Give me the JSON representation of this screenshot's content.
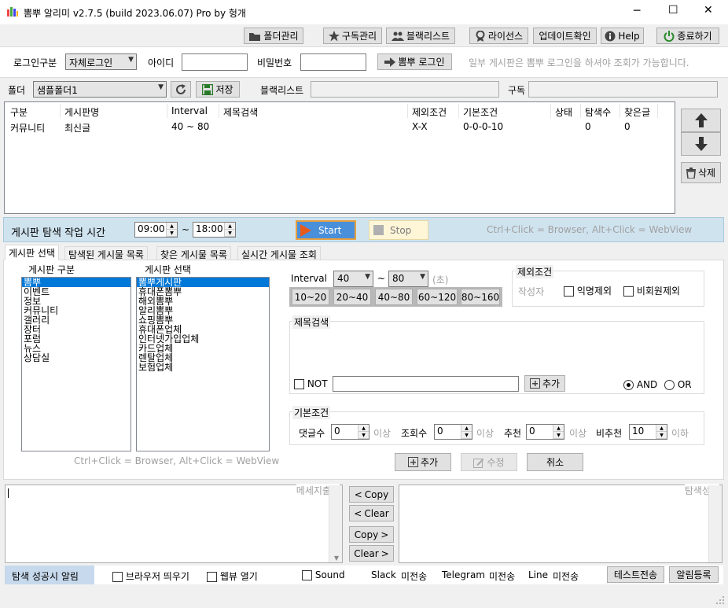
{
  "window": {
    "title": "뽐뿌 알리미 v2.7.5 (build 2023.06.07) Pro by 헝개",
    "minimize": "─",
    "maximize": "☐",
    "close": "✕"
  },
  "toolbar": {
    "folder_manage": "폴더관리",
    "subscribe_manage": "구독관리",
    "blacklist": "블랙리스트",
    "license": "라이선스",
    "update_check": "업데이트확인",
    "help": "Help",
    "exit": "종료하기"
  },
  "login": {
    "type_label": "로그인구분",
    "type_value": "자체로그인",
    "id_label": "아이디",
    "id_value": "",
    "pw_label": "비밀번호",
    "pw_value": "",
    "login_button": "뽐뿌 로그인",
    "notice": "일부 게시판은 뽐뿌 로그인을 하셔야 조회가 가능합니다."
  },
  "folder": {
    "label": "폴더",
    "value": "샘플폴더1",
    "save": "저장",
    "blacklist_label": "블랙리스트",
    "subscribe_label": "구독"
  },
  "table": {
    "headers": [
      "구분",
      "게시판명",
      "Interval",
      "제목검색",
      "제외조건",
      "기본조건",
      "상태",
      "탐색수",
      "찾은글"
    ],
    "rows": [
      [
        "커뮤니티",
        "최신글",
        "40 ~ 80",
        "",
        "X-X",
        "0-0-0-10",
        "",
        "0",
        "0"
      ]
    ]
  },
  "side_buttons": {
    "delete": "삭제"
  },
  "schedule": {
    "label": "게시판 탐색 작업 시간",
    "start_time": "09:00",
    "tilde": "~",
    "end_time": "18:00",
    "start": "Start",
    "stop": "Stop",
    "hint": "Ctrl+Click = Browser, Alt+Click = WebView"
  },
  "tabs": [
    "게시판 선택",
    "탐색된 게시물 목록",
    "찾은 게시물 목록",
    "실시간 게시물 조회"
  ],
  "board_select": {
    "category_label": "게시판 구분",
    "board_label": "게시판 선택",
    "categories": [
      "뽐뿌",
      "이벤트",
      "정보",
      "커뮤니티",
      "갤러리",
      "장터",
      "포럼",
      "뉴스",
      "상담실"
    ],
    "boards": [
      "뽐뿌게시판",
      "휴대폰뽐뿌",
      "해외뽐뿌",
      "알리뽐뿌",
      "쇼핑뽐뿌",
      "휴대폰업체",
      "인터넷가입업체",
      "카드업체",
      "렌탈업체",
      "보험업체"
    ],
    "hint": "Ctrl+Click = Browser, Alt+Click = WebView"
  },
  "interval": {
    "label": "Interval",
    "from": "40",
    "tilde": "~",
    "to": "80",
    "unit": "(초)",
    "presets": [
      "10~20",
      "20~40",
      "40~80",
      "60~120",
      "80~160"
    ]
  },
  "exclude": {
    "title": "제외조건",
    "author_label": "작성자",
    "anonymous": "익명제외",
    "nonmember": "비회원제외"
  },
  "title_search": {
    "title": "제목검색",
    "not_label": "NOT",
    "input_value": "",
    "add": "추가",
    "and": "AND",
    "or": "OR"
  },
  "basic": {
    "title": "기본조건",
    "comments_label": "댓글수",
    "comments_value": "0",
    "views_label": "조회수",
    "views_value": "0",
    "recommend_label": "추천",
    "recommend_value": "0",
    "unrecommend_label": "비추천",
    "unrecommend_value": "10",
    "above": "이상",
    "below": "이하"
  },
  "actions": {
    "add": "추가",
    "edit": "수정",
    "cancel": "취소"
  },
  "log": {
    "message_title": "메세지출력",
    "success_title": "탐색성공",
    "copy": "Copy",
    "clear": "Clear"
  },
  "footer": {
    "label": "탐색 성공시 알림",
    "browser": "브라우저 띄우기",
    "webview": "웹뷰 열기",
    "sound": "Sound",
    "slack": "Slack",
    "slack_status": "미전송",
    "telegram": "Telegram",
    "telegram_status": "미전송",
    "line": "Line",
    "line_status": "미전송",
    "test_send": "테스트전송",
    "register": "알림등록"
  },
  "colors": {
    "accent_blue": "#0078d7",
    "schedule_bg": "#cfe3ef",
    "start_bg": "#4a8fd9",
    "stop_bg": "#fff6d8",
    "footer_bg": "#c7d9ec"
  }
}
